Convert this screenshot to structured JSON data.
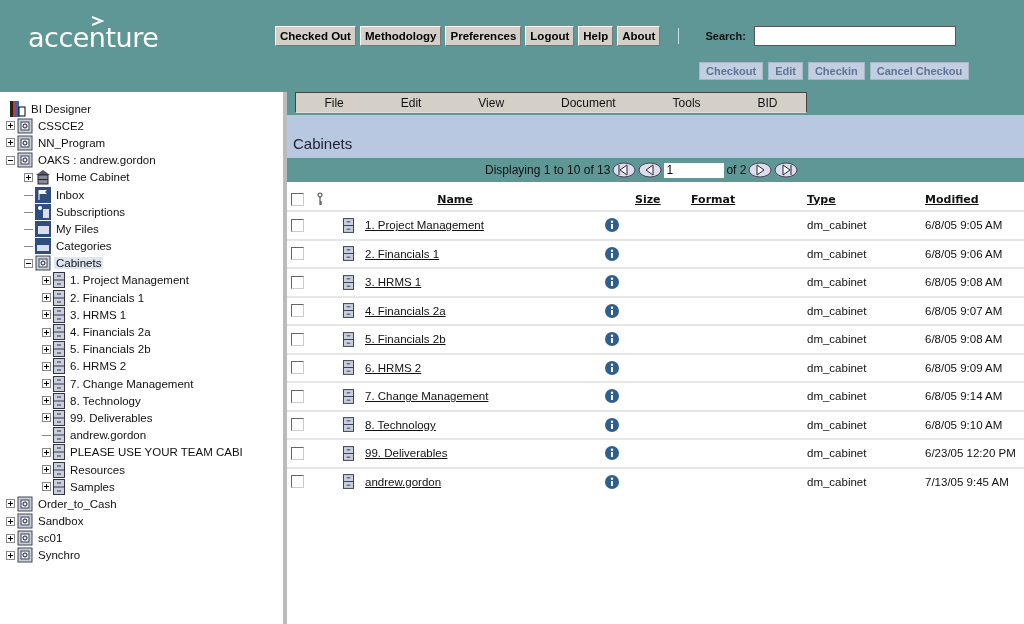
{
  "header": {
    "logo": "accenture",
    "nav_buttons": [
      "Checked Out",
      "Methodology",
      "Preferences",
      "Logout",
      "Help",
      "About"
    ],
    "search": {
      "label": "Search:"
    },
    "actions": [
      {
        "label": "Checkout",
        "disabled": true
      },
      {
        "label": "Edit",
        "disabled": true
      },
      {
        "label": "Checkin",
        "disabled": true
      },
      {
        "label": "Cancel Checkou",
        "disabled": true
      }
    ]
  },
  "tree": {
    "root": "BI Designer",
    "items": [
      {
        "label": "CSSCE2",
        "kind": "repository",
        "expanded": false
      },
      {
        "label": "NN_Program",
        "kind": "repository",
        "expanded": false
      },
      {
        "label": "OAKS : andrew.gordon",
        "kind": "repository",
        "expanded": true,
        "children": [
          {
            "label": "Home Cabinet",
            "kind": "home",
            "expanded": false
          },
          {
            "label": "Inbox",
            "kind": "inbox"
          },
          {
            "label": "Subscriptions",
            "kind": "subscriptions"
          },
          {
            "label": "My Files",
            "kind": "myfiles"
          },
          {
            "label": "Categories",
            "kind": "categories"
          },
          {
            "label": "Cabinets",
            "kind": "repository",
            "expanded": true,
            "selected": true,
            "children": [
              {
                "label": "1. Project Management",
                "kind": "cabinet",
                "expanded": false
              },
              {
                "label": "2. Financials 1",
                "kind": "cabinet",
                "expanded": false
              },
              {
                "label": "3. HRMS 1",
                "kind": "cabinet",
                "expanded": false
              },
              {
                "label": "4. Financials 2a",
                "kind": "cabinet",
                "expanded": false
              },
              {
                "label": "5. Financials 2b",
                "kind": "cabinet",
                "expanded": false
              },
              {
                "label": "6. HRMS 2",
                "kind": "cabinet",
                "expanded": false
              },
              {
                "label": "7. Change Management",
                "kind": "cabinet",
                "expanded": false
              },
              {
                "label": "8. Technology",
                "kind": "cabinet",
                "expanded": false
              },
              {
                "label": "99. Deliverables",
                "kind": "cabinet",
                "expanded": false
              },
              {
                "label": "andrew.gordon",
                "kind": "cabinet"
              },
              {
                "label": "PLEASE USE YOUR TEAM CABI",
                "kind": "cabinet",
                "expanded": false
              },
              {
                "label": "Resources",
                "kind": "cabinet",
                "expanded": false
              },
              {
                "label": "Samples",
                "kind": "cabinet",
                "expanded": false
              }
            ]
          }
        ]
      },
      {
        "label": "Order_to_Cash",
        "kind": "repository",
        "expanded": false
      },
      {
        "label": "Sandbox",
        "kind": "repository",
        "expanded": false
      },
      {
        "label": "sc01",
        "kind": "repository",
        "expanded": false
      },
      {
        "label": "Synchro",
        "kind": "repository",
        "expanded": false
      }
    ]
  },
  "menu": [
    "File",
    "Edit",
    "View",
    "Document",
    "Tools",
    "BID"
  ],
  "page_title": "Cabinets",
  "pager": {
    "summary": "Displaying 1 to 10 of 13",
    "page": "1",
    "of": "of 2"
  },
  "table": {
    "columns": [
      "Name",
      "Size",
      "Format",
      "Type",
      "Modified"
    ],
    "select_all": false,
    "rows": [
      {
        "checked": false,
        "name": "1. Project Management",
        "type": "dm_cabinet",
        "modified": "6/8/05 9:05 AM"
      },
      {
        "checked": false,
        "name": "2. Financials 1",
        "type": "dm_cabinet",
        "modified": "6/8/05 9:06 AM"
      },
      {
        "checked": false,
        "name": "3. HRMS 1",
        "type": "dm_cabinet",
        "modified": "6/8/05 9:08 AM"
      },
      {
        "checked": false,
        "name": "4. Financials 2a",
        "type": "dm_cabinet",
        "modified": "6/8/05 9:07 AM"
      },
      {
        "checked": false,
        "name": "5. Financials 2b",
        "type": "dm_cabinet",
        "modified": "6/8/05 9:08 AM"
      },
      {
        "checked": false,
        "name": "6. HRMS 2",
        "type": "dm_cabinet",
        "modified": "6/8/05 9:09 AM"
      },
      {
        "checked": false,
        "name": "7. Change Management",
        "type": "dm_cabinet",
        "modified": "6/8/05 9:14 AM"
      },
      {
        "checked": false,
        "name": "8. Technology",
        "type": "dm_cabinet",
        "modified": "6/8/05 9:10 AM"
      },
      {
        "checked": false,
        "name": "99. Deliverables",
        "type": "dm_cabinet",
        "modified": "6/23/05 12:20 PM"
      },
      {
        "checked": false,
        "name": "andrew.gordon",
        "type": "dm_cabinet",
        "modified": "7/13/05 9:45 AM"
      }
    ]
  }
}
